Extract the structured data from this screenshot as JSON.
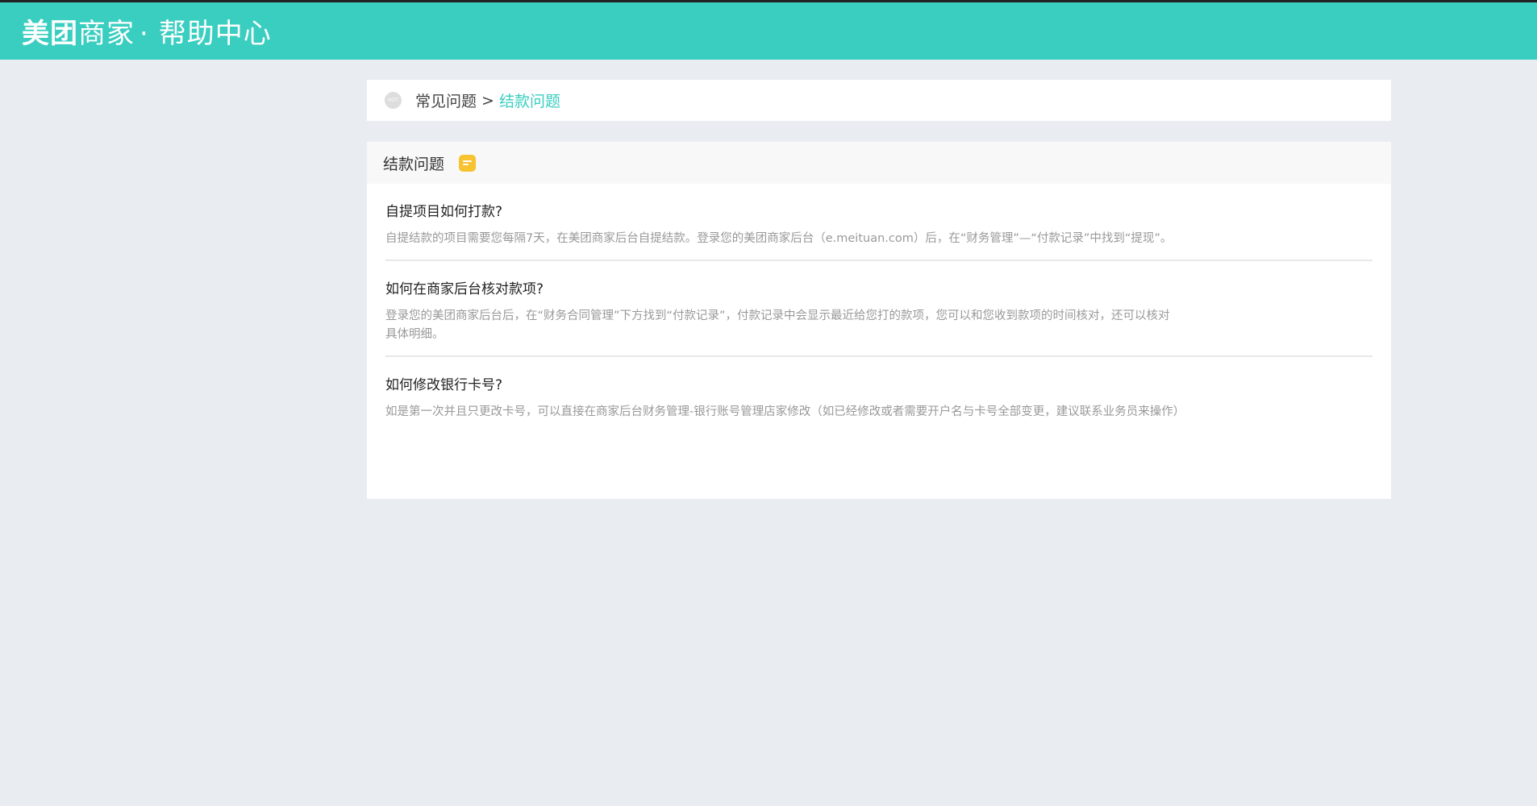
{
  "header": {
    "brand_bold": "美团",
    "brand_rest": "商家",
    "dot": "·",
    "subtitle": "帮助中心"
  },
  "breadcrumb": {
    "badge": "HOT",
    "parent": "常见问题",
    "separator": ">",
    "current": "结款问题"
  },
  "section": {
    "title": "结款问题",
    "icon": "note-icon"
  },
  "faqs": [
    {
      "question": "自提项目如何打款?",
      "answer": "自提结款的项目需要您每隔7天，在美团商家后台自提结款。登录您的美团商家后台（e.meituan.com）后，在“财务管理”—“付款记录”中找到“提现”。"
    },
    {
      "question": "如何在商家后台核对款项?",
      "answer": "登录您的美团商家后台后，在“财务合同管理”下方找到“付款记录”，付款记录中会显示最近给您打的款项，您可以和您收到款项的时间核对，还可以核对具体明细。"
    },
    {
      "question": "如何修改银行卡号?",
      "answer": "如是第一次并且只更改卡号，可以直接在商家后台财务管理-银行账号管理店家修改（如已经修改或者需要开户名与卡号全部变更，建议联系业务员来操作）"
    }
  ],
  "colors": {
    "brand": "#39cec0",
    "note": "#f7c331"
  }
}
